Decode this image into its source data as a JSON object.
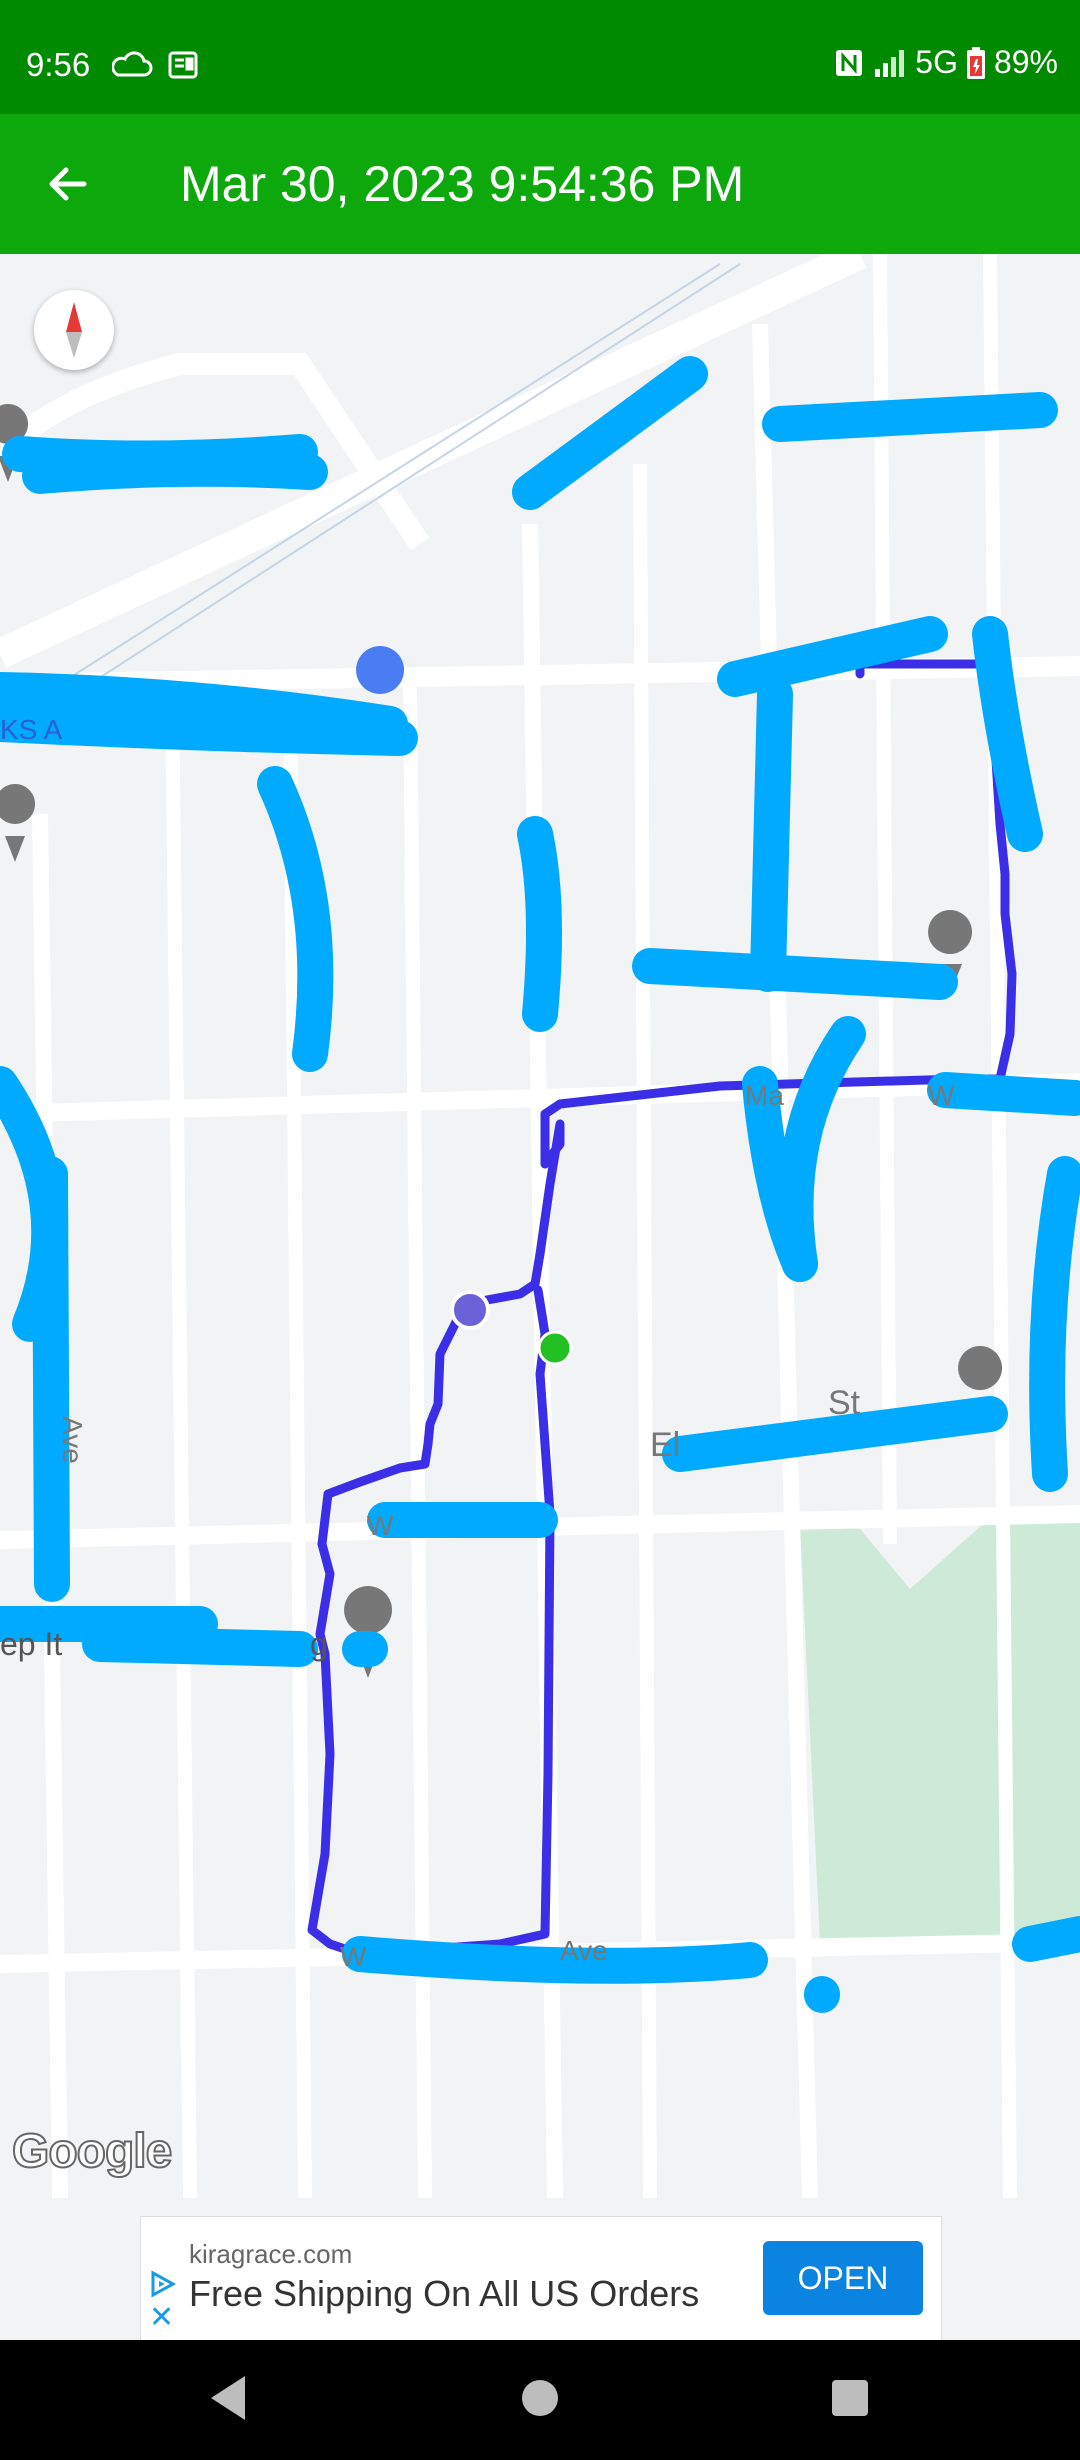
{
  "status_bar": {
    "time": "9:56",
    "network": "5G",
    "battery": "89%",
    "icons": [
      "cloud-icon",
      "news-icon",
      "nfc-icon",
      "signal-icon",
      "battery-icon"
    ]
  },
  "app_bar": {
    "title": "Mar 30, 2023 9:54:36 PM",
    "back_icon": "arrow-left-icon",
    "background": "#0ca80c"
  },
  "map": {
    "labels": [
      "KS A",
      "Ma",
      "W",
      "W",
      "W",
      "Ave",
      "El",
      "St",
      "Ave",
      "ep It",
      "g"
    ],
    "route_color": "#3a2fe6",
    "start_marker_color": "#22c022",
    "end_marker_color": "#6a62d6",
    "redaction_color": "#00aaff"
  },
  "attribution": "Google",
  "ad": {
    "domain": "kiragrace.com",
    "headline": "Free Shipping On All US Orders",
    "cta": "OPEN"
  },
  "nav_bar": {
    "items": [
      "back-icon",
      "home-icon",
      "recents-icon"
    ]
  }
}
